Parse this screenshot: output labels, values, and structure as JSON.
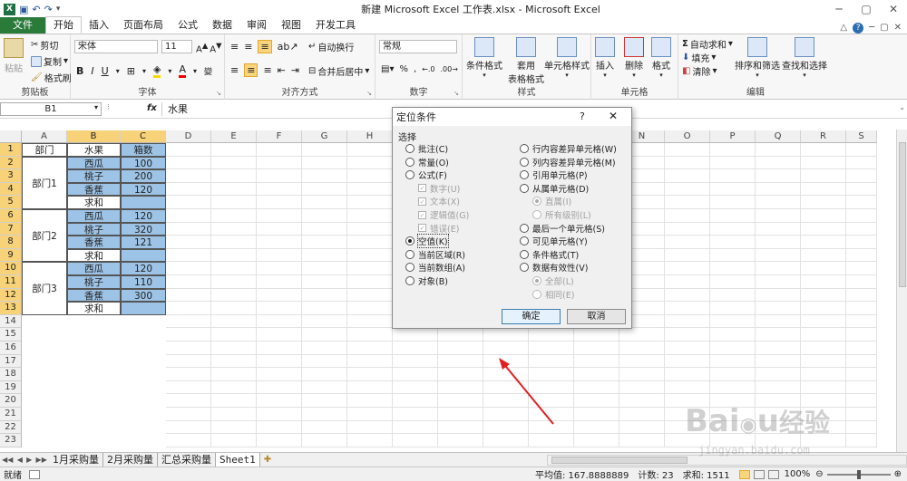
{
  "window": {
    "title": "新建 Microsoft Excel 工作表.xlsx - Microsoft Excel"
  },
  "tabs": [
    "文件",
    "开始",
    "插入",
    "页面布局",
    "公式",
    "数据",
    "审阅",
    "视图",
    "开发工具"
  ],
  "active_tab": "开始",
  "ribbon": {
    "clipboard": {
      "paste": "粘贴",
      "cut": "剪切",
      "copy": "复制",
      "format_painter": "格式刷",
      "label": "剪贴板"
    },
    "font": {
      "name": "宋体",
      "size": "11",
      "label": "字体"
    },
    "alignment": {
      "wrap": "自动换行",
      "merge": "合并后居中",
      "label": "对齐方式"
    },
    "number": {
      "format": "常规",
      "label": "数字"
    },
    "styles": {
      "conditional": "条件格式",
      "table_format_1": "套用",
      "table_format_2": "表格格式",
      "cell_styles": "单元格样式",
      "label": "样式"
    },
    "cells": {
      "insert": "插入",
      "delete": "删除",
      "format": "格式",
      "label": "单元格"
    },
    "editing": {
      "autosum": "自动求和",
      "fill": "填充",
      "clear": "清除",
      "sort_filter": "排序和筛选",
      "find_select": "查找和选择",
      "label": "编辑"
    }
  },
  "formula_bar": {
    "name_box": "B1",
    "fx": "fx",
    "content": "水果"
  },
  "columns": [
    "A",
    "B",
    "C",
    "D",
    "E",
    "F",
    "G",
    "H",
    "I",
    "J",
    "K",
    "L",
    "M",
    "N",
    "O",
    "P",
    "Q",
    "R",
    "S"
  ],
  "rows": [
    "1",
    "2",
    "3",
    "4",
    "5",
    "6",
    "7",
    "8",
    "9",
    "10",
    "11",
    "12",
    "13",
    "14",
    "15",
    "16",
    "17",
    "18",
    "19",
    "20",
    "21",
    "22",
    "23"
  ],
  "sheet": {
    "header": [
      "部门",
      "水果",
      "箱数"
    ],
    "groups": [
      {
        "dept": "部门1",
        "items": [
          [
            "西瓜",
            "100"
          ],
          [
            "桃子",
            "200"
          ],
          [
            "香蕉",
            "120"
          ],
          [
            "求和",
            ""
          ]
        ]
      },
      {
        "dept": "部门2",
        "items": [
          [
            "西瓜",
            "120"
          ],
          [
            "桃子",
            "320"
          ],
          [
            "香蕉",
            "121"
          ],
          [
            "求和",
            ""
          ]
        ]
      },
      {
        "dept": "部门3",
        "items": [
          [
            "西瓜",
            "120"
          ],
          [
            "桃子",
            "110"
          ],
          [
            "香蕉",
            "300"
          ],
          [
            "求和",
            ""
          ]
        ]
      }
    ]
  },
  "sheet_tabs": [
    "1月采购量",
    "2月采购量",
    "汇总采购量",
    "Sheet1"
  ],
  "active_sheet": "Sheet1",
  "status": {
    "ready": "就绪",
    "average": "平均值: 167.8888889",
    "count": "计数: 23",
    "sum": "求和: 1511",
    "zoom": "100%"
  },
  "dialog": {
    "title": "定位条件",
    "help": "?",
    "section": "选择",
    "left": [
      {
        "label": "批注(C)",
        "on": false,
        "type": "radio"
      },
      {
        "label": "常量(O)",
        "on": false,
        "type": "radio"
      },
      {
        "label": "公式(F)",
        "on": false,
        "type": "radio"
      },
      {
        "label": "数字(U)",
        "on": true,
        "type": "check",
        "disabled": true
      },
      {
        "label": "文本(X)",
        "on": true,
        "type": "check",
        "disabled": true
      },
      {
        "label": "逻辑值(G)",
        "on": true,
        "type": "check",
        "disabled": true
      },
      {
        "label": "错误(E)",
        "on": true,
        "type": "check",
        "disabled": true
      },
      {
        "label": "空值(K)",
        "on": true,
        "type": "radio"
      },
      {
        "label": "当前区域(R)",
        "on": false,
        "type": "radio"
      },
      {
        "label": "当前数组(A)",
        "on": false,
        "type": "radio"
      },
      {
        "label": "对象(B)",
        "on": false,
        "type": "radio"
      }
    ],
    "right": [
      {
        "label": "行内容差异单元格(W)",
        "on": false,
        "type": "radio"
      },
      {
        "label": "列内容差异单元格(M)",
        "on": false,
        "type": "radio"
      },
      {
        "label": "引用单元格(P)",
        "on": false,
        "type": "radio"
      },
      {
        "label": "从属单元格(D)",
        "on": false,
        "type": "radio"
      },
      {
        "label": "直属(I)",
        "on": true,
        "type": "radio",
        "disabled": true
      },
      {
        "label": "所有级别(L)",
        "on": false,
        "type": "radio",
        "disabled": true
      },
      {
        "label": "最后一个单元格(S)",
        "on": false,
        "type": "radio"
      },
      {
        "label": "可见单元格(Y)",
        "on": false,
        "type": "radio"
      },
      {
        "label": "条件格式(T)",
        "on": false,
        "type": "radio"
      },
      {
        "label": "数据有效性(V)",
        "on": false,
        "type": "radio"
      },
      {
        "label": "全部(L)",
        "on": true,
        "type": "radio",
        "disabled": true
      },
      {
        "label": "相同(E)",
        "on": false,
        "type": "radio",
        "disabled": true
      }
    ],
    "ok": "确定",
    "cancel": "取消"
  }
}
